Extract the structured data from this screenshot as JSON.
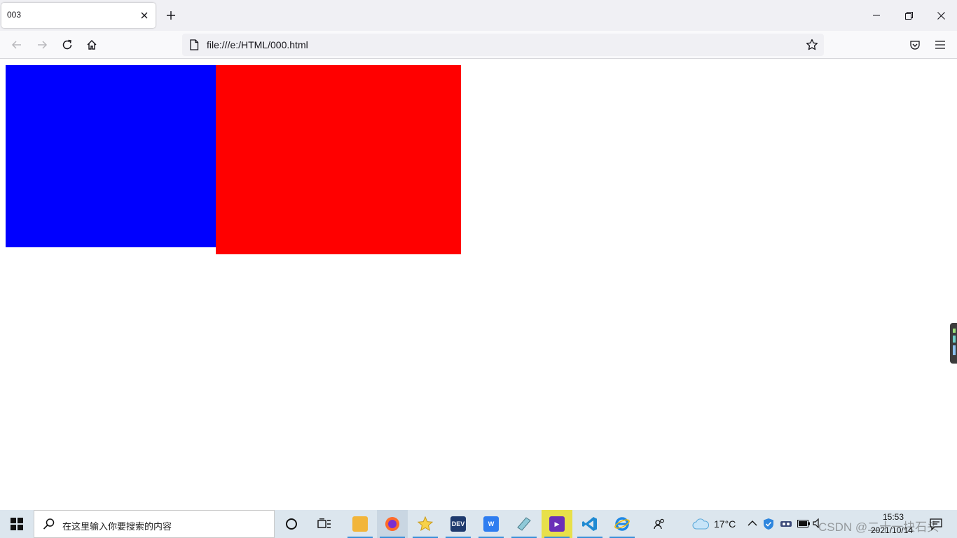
{
  "browser": {
    "tab": {
      "title": "003"
    },
    "url": "file:///e:/HTML/000.html"
  },
  "content": {
    "boxes": [
      {
        "name": "blue-box",
        "color": "#0000ff"
      },
      {
        "name": "red-box",
        "color": "#ff0000"
      }
    ]
  },
  "taskbar": {
    "search_placeholder": "在这里输入你要搜索的内容",
    "weather": "17°C",
    "time": "15:53",
    "date": "2021/10/14",
    "watermark": "CSDN @二十一块石头"
  },
  "icons": {
    "close": "close-icon",
    "new_tab": "plus-icon",
    "back": "back-arrow-icon",
    "forward": "forward-arrow-icon",
    "reload": "reload-icon",
    "home": "home-icon",
    "page": "page-icon",
    "bookmark": "star-icon",
    "pocket": "pocket-icon",
    "menu": "hamburger-menu-icon"
  }
}
